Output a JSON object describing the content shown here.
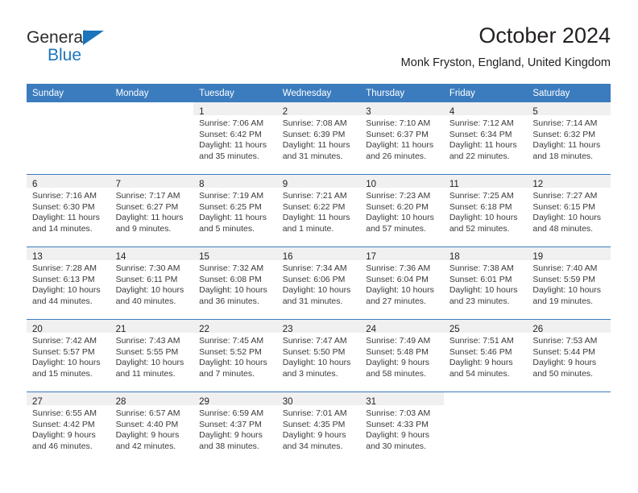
{
  "brand": {
    "line1": "General",
    "line2": "Blue",
    "triangle_color": "#1b75bb"
  },
  "header": {
    "title": "October 2024",
    "subtitle": "Monk Fryston, England, United Kingdom",
    "accent_color": "#3b7cbe",
    "daynum_band_color": "#f0f0f0"
  },
  "calendar": {
    "weekday_headers": [
      "Sunday",
      "Monday",
      "Tuesday",
      "Wednesday",
      "Thursday",
      "Friday",
      "Saturday"
    ],
    "weeks": [
      [
        {
          "day": "",
          "lines": []
        },
        {
          "day": "",
          "lines": []
        },
        {
          "day": "1",
          "lines": [
            "Sunrise: 7:06 AM",
            "Sunset: 6:42 PM",
            "Daylight: 11 hours",
            "and 35 minutes."
          ]
        },
        {
          "day": "2",
          "lines": [
            "Sunrise: 7:08 AM",
            "Sunset: 6:39 PM",
            "Daylight: 11 hours",
            "and 31 minutes."
          ]
        },
        {
          "day": "3",
          "lines": [
            "Sunrise: 7:10 AM",
            "Sunset: 6:37 PM",
            "Daylight: 11 hours",
            "and 26 minutes."
          ]
        },
        {
          "day": "4",
          "lines": [
            "Sunrise: 7:12 AM",
            "Sunset: 6:34 PM",
            "Daylight: 11 hours",
            "and 22 minutes."
          ]
        },
        {
          "day": "5",
          "lines": [
            "Sunrise: 7:14 AM",
            "Sunset: 6:32 PM",
            "Daylight: 11 hours",
            "and 18 minutes."
          ]
        }
      ],
      [
        {
          "day": "6",
          "lines": [
            "Sunrise: 7:16 AM",
            "Sunset: 6:30 PM",
            "Daylight: 11 hours",
            "and 14 minutes."
          ]
        },
        {
          "day": "7",
          "lines": [
            "Sunrise: 7:17 AM",
            "Sunset: 6:27 PM",
            "Daylight: 11 hours",
            "and 9 minutes."
          ]
        },
        {
          "day": "8",
          "lines": [
            "Sunrise: 7:19 AM",
            "Sunset: 6:25 PM",
            "Daylight: 11 hours",
            "and 5 minutes."
          ]
        },
        {
          "day": "9",
          "lines": [
            "Sunrise: 7:21 AM",
            "Sunset: 6:22 PM",
            "Daylight: 11 hours",
            "and 1 minute."
          ]
        },
        {
          "day": "10",
          "lines": [
            "Sunrise: 7:23 AM",
            "Sunset: 6:20 PM",
            "Daylight: 10 hours",
            "and 57 minutes."
          ]
        },
        {
          "day": "11",
          "lines": [
            "Sunrise: 7:25 AM",
            "Sunset: 6:18 PM",
            "Daylight: 10 hours",
            "and 52 minutes."
          ]
        },
        {
          "day": "12",
          "lines": [
            "Sunrise: 7:27 AM",
            "Sunset: 6:15 PM",
            "Daylight: 10 hours",
            "and 48 minutes."
          ]
        }
      ],
      [
        {
          "day": "13",
          "lines": [
            "Sunrise: 7:28 AM",
            "Sunset: 6:13 PM",
            "Daylight: 10 hours",
            "and 44 minutes."
          ]
        },
        {
          "day": "14",
          "lines": [
            "Sunrise: 7:30 AM",
            "Sunset: 6:11 PM",
            "Daylight: 10 hours",
            "and 40 minutes."
          ]
        },
        {
          "day": "15",
          "lines": [
            "Sunrise: 7:32 AM",
            "Sunset: 6:08 PM",
            "Daylight: 10 hours",
            "and 36 minutes."
          ]
        },
        {
          "day": "16",
          "lines": [
            "Sunrise: 7:34 AM",
            "Sunset: 6:06 PM",
            "Daylight: 10 hours",
            "and 31 minutes."
          ]
        },
        {
          "day": "17",
          "lines": [
            "Sunrise: 7:36 AM",
            "Sunset: 6:04 PM",
            "Daylight: 10 hours",
            "and 27 minutes."
          ]
        },
        {
          "day": "18",
          "lines": [
            "Sunrise: 7:38 AM",
            "Sunset: 6:01 PM",
            "Daylight: 10 hours",
            "and 23 minutes."
          ]
        },
        {
          "day": "19",
          "lines": [
            "Sunrise: 7:40 AM",
            "Sunset: 5:59 PM",
            "Daylight: 10 hours",
            "and 19 minutes."
          ]
        }
      ],
      [
        {
          "day": "20",
          "lines": [
            "Sunrise: 7:42 AM",
            "Sunset: 5:57 PM",
            "Daylight: 10 hours",
            "and 15 minutes."
          ]
        },
        {
          "day": "21",
          "lines": [
            "Sunrise: 7:43 AM",
            "Sunset: 5:55 PM",
            "Daylight: 10 hours",
            "and 11 minutes."
          ]
        },
        {
          "day": "22",
          "lines": [
            "Sunrise: 7:45 AM",
            "Sunset: 5:52 PM",
            "Daylight: 10 hours",
            "and 7 minutes."
          ]
        },
        {
          "day": "23",
          "lines": [
            "Sunrise: 7:47 AM",
            "Sunset: 5:50 PM",
            "Daylight: 10 hours",
            "and 3 minutes."
          ]
        },
        {
          "day": "24",
          "lines": [
            "Sunrise: 7:49 AM",
            "Sunset: 5:48 PM",
            "Daylight: 9 hours",
            "and 58 minutes."
          ]
        },
        {
          "day": "25",
          "lines": [
            "Sunrise: 7:51 AM",
            "Sunset: 5:46 PM",
            "Daylight: 9 hours",
            "and 54 minutes."
          ]
        },
        {
          "day": "26",
          "lines": [
            "Sunrise: 7:53 AM",
            "Sunset: 5:44 PM",
            "Daylight: 9 hours",
            "and 50 minutes."
          ]
        }
      ],
      [
        {
          "day": "27",
          "lines": [
            "Sunrise: 6:55 AM",
            "Sunset: 4:42 PM",
            "Daylight: 9 hours",
            "and 46 minutes."
          ]
        },
        {
          "day": "28",
          "lines": [
            "Sunrise: 6:57 AM",
            "Sunset: 4:40 PM",
            "Daylight: 9 hours",
            "and 42 minutes."
          ]
        },
        {
          "day": "29",
          "lines": [
            "Sunrise: 6:59 AM",
            "Sunset: 4:37 PM",
            "Daylight: 9 hours",
            "and 38 minutes."
          ]
        },
        {
          "day": "30",
          "lines": [
            "Sunrise: 7:01 AM",
            "Sunset: 4:35 PM",
            "Daylight: 9 hours",
            "and 34 minutes."
          ]
        },
        {
          "day": "31",
          "lines": [
            "Sunrise: 7:03 AM",
            "Sunset: 4:33 PM",
            "Daylight: 9 hours",
            "and 30 minutes."
          ]
        },
        {
          "day": "",
          "lines": []
        },
        {
          "day": "",
          "lines": []
        }
      ]
    ]
  }
}
